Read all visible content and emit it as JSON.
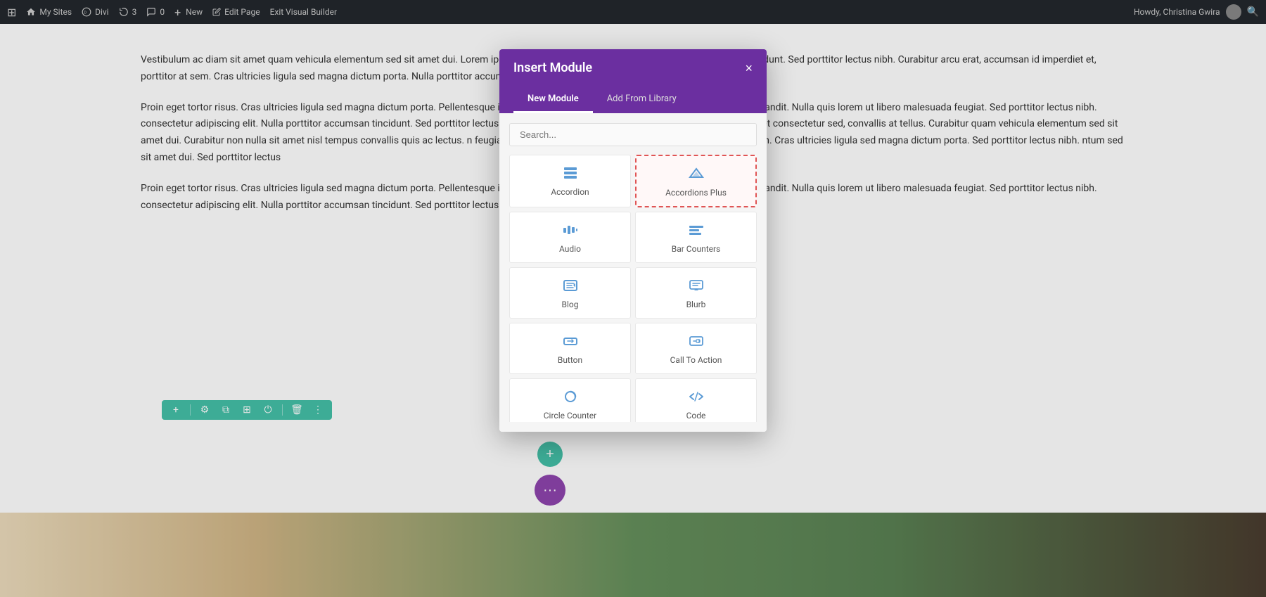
{
  "topbar": {
    "wp_icon": "⊞",
    "my_sites": "My Sites",
    "divi": "Divi",
    "revisions": "3",
    "comments": "0",
    "new_label": "New",
    "edit_page": "Edit Page",
    "exit_builder": "Exit Visual Builder",
    "user_greeting": "Howdy, Christina Gwira"
  },
  "page_paragraphs": [
    "Vestibulum ac diam sit amet quam vehicula elementum sed sit amet dui. Lorem ipsum libero malesuada feugiat. Nulla porttitor accumsan tincidunt. Sed porttitor lectus nibh. Curabitur arcu erat, accumsan id imperdiet et, porttitor at sem. Cras ultricies ligula sed magna dictum porta. Nulla porttitor accumsan tincidunt. Sed porttitor lectus nibh. malesuada.",
    "Proin eget tortor risus. Cras ultricies ligula sed magna dictum porta. Pellentesque in ipsum id orci porta dapibus. Aliquet quam id dui posuere blandit. Nulla quis lorem ut libero malesuada feugiat. Sed porttitor lectus nibh. consectetur adipiscing elit. Nulla porttitor accumsan tincidunt. Sed porttitor lectus nibh. elis porttitor volutpat. Vivamus magna justo, lacinia eget consectetur sed, convallis at tellus. Curabitur quam vehicula elementum sed sit amet dui. Curabitur non nulla sit amet nisl tempus convallis quis ac lectus. n feugiat. Nulla porttitor accumsan tincidunt. Sed porttitor lectus nibh. Cras ultricies ligula sed magna dictum porta. Sed porttitor lectus nibh. ntum sed sit amet dui. Sed porttitor lectus",
    "Proin eget tortor risus. Cras ultricies ligula sed magna dictum porta. Pellentesque in ipsum id orci porta dapibus. Aliquet quam id dui posuere blandit. Nulla quis lorem ut libero malesuada feugiat. Sed porttitor lectus nibh. consectetur adipiscing elit. Nulla porttitor accumsan tincidunt. Sed porttitor lectus nibh. elis porttitor volutpat. Vivamus magna justo,"
  ],
  "toolbar": {
    "plus_icon": "+",
    "settings_icon": "⚙",
    "copy_icon": "⧉",
    "grid_icon": "⊞",
    "power_icon": "⏻",
    "trash_icon": "🗑",
    "dots_icon": "⋮"
  },
  "modal": {
    "title": "Insert Module",
    "close_icon": "×",
    "tab_new": "New Module",
    "tab_library": "Add From Library",
    "search_placeholder": "Search...",
    "modules": [
      {
        "id": "accordion",
        "label": "Accordion",
        "icon": "≡",
        "highlighted": false
      },
      {
        "id": "accordions-plus",
        "label": "Accordions Plus",
        "icon": "⌃",
        "highlighted": true
      },
      {
        "id": "audio",
        "label": "Audio",
        "icon": "🔊",
        "highlighted": false
      },
      {
        "id": "bar-counters",
        "label": "Bar Counters",
        "icon": "≣",
        "highlighted": false
      },
      {
        "id": "blog",
        "label": "Blog",
        "icon": "✎",
        "highlighted": false
      },
      {
        "id": "blurb",
        "label": "Blurb",
        "icon": "💬",
        "highlighted": false
      },
      {
        "id": "button",
        "label": "Button",
        "icon": "⬜",
        "highlighted": false
      },
      {
        "id": "call-to-action",
        "label": "Call To Action",
        "icon": "📣",
        "highlighted": false
      },
      {
        "id": "circle-counter",
        "label": "Circle Counter",
        "icon": "◎",
        "highlighted": false
      },
      {
        "id": "code",
        "label": "Code",
        "icon": "</>",
        "highlighted": false
      }
    ]
  }
}
